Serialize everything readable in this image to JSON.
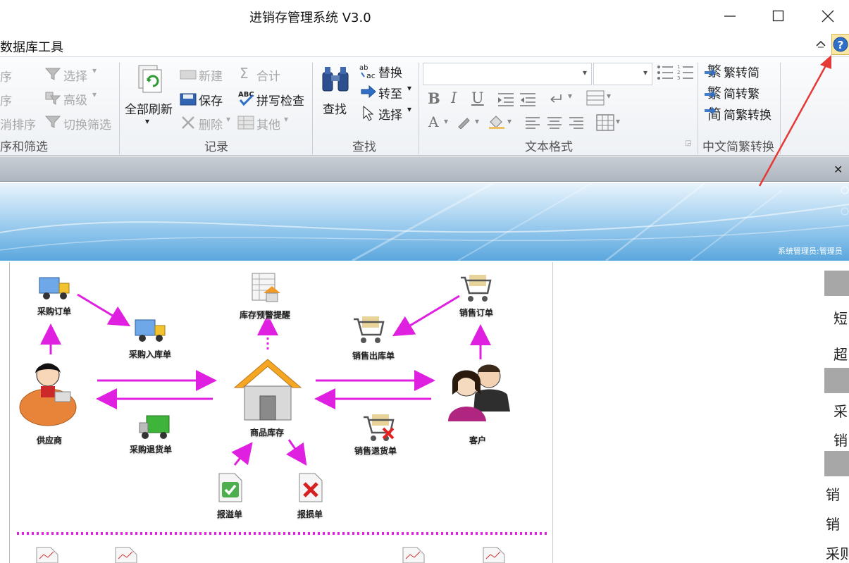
{
  "window": {
    "title": "进销存管理系统 V3.0",
    "minimize_icon": "minimize-icon",
    "maximize_icon": "maximize-icon",
    "close_icon": "close-icon"
  },
  "menu": {
    "tab_label": "数据库工具",
    "help_icon": "help-icon"
  },
  "ribbon": {
    "sort_filter": {
      "label": "序和筛选",
      "items": [
        "序",
        "序",
        "消排序"
      ],
      "select": "选择",
      "advanced": "高级",
      "toggle_filter": "切换筛选"
    },
    "records": {
      "label": "记录",
      "refresh_all": "全部刷新",
      "new": "新建",
      "save": "保存",
      "delete": "删除",
      "totals": "合计",
      "spelling": "拼写检查",
      "more": "其他"
    },
    "find": {
      "label": "查找",
      "find": "查找",
      "replace": "替换",
      "goto": "转至",
      "select": "选择"
    },
    "text_format": {
      "label": "文本格式",
      "bold": "B",
      "italic": "I",
      "underline": "U",
      "font_color": "A"
    },
    "chinese_conversion": {
      "label": "中文简繁转换",
      "trad_to_simp": "繁转简",
      "simp_to_trad": "简转繁",
      "convert": "简繁转换"
    }
  },
  "banner": {
    "status_text": "系统管理员:管理员"
  },
  "workflow": {
    "purchase_order": "采购订单",
    "purchase_in": "采购入库单",
    "stock_alert": "库存预警提醒",
    "sales_order": "销售订单",
    "sales_out": "销售出库单",
    "supplier": "供应商",
    "inventory": "商品库存",
    "customer": "客户",
    "purchase_return": "采购退货单",
    "sales_return": "销售退货单",
    "overflow": "报溢单",
    "loss": "报损单"
  },
  "right_panel": {
    "items": [
      "短",
      "超",
      "采",
      "销",
      "销",
      "销",
      "采则"
    ]
  },
  "colors": {
    "arrow": "#e020e0",
    "accent_red": "#e53935"
  }
}
